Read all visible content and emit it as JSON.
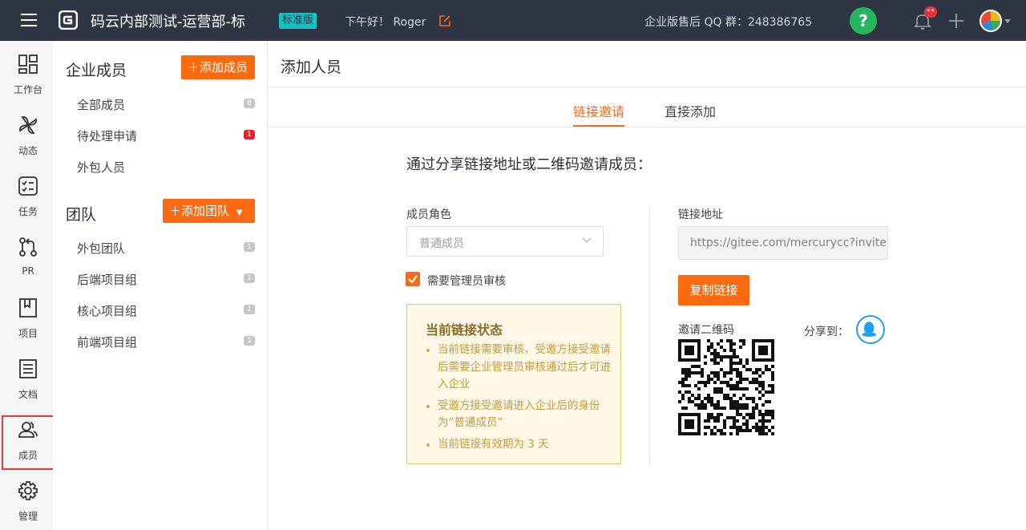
{
  "header": {
    "org_name": "码云内部测试-运营部-标",
    "edition": "标准版",
    "greeting": "下午好！ Roger",
    "qq_group": "企业版售后 QQ 群：248386765",
    "help": "?",
    "notification_badge": "••"
  },
  "leftnav": {
    "items": [
      {
        "label": "工作台",
        "icon": "grid-icon"
      },
      {
        "label": "动态",
        "icon": "pinwheel-icon"
      },
      {
        "label": "任务",
        "icon": "checklist-icon"
      },
      {
        "label": "PR",
        "icon": "pull-request-icon"
      },
      {
        "label": "项目",
        "icon": "book-icon"
      },
      {
        "label": "文档",
        "icon": "document-icon"
      },
      {
        "label": "成员",
        "icon": "users-icon"
      },
      {
        "label": "管理",
        "icon": "gear-icon"
      }
    ],
    "active": "成员"
  },
  "subnav": {
    "members_title": "企业成员",
    "add_member": "添加成员",
    "member_items": [
      {
        "label": "全部成员",
        "count": "8"
      },
      {
        "label": "待处理申请",
        "count": "1"
      },
      {
        "label": "外包人员",
        "count": ""
      }
    ],
    "teams_title": "团队",
    "add_team": "添加团队",
    "team_items": [
      {
        "label": "外包团队",
        "count": "1"
      },
      {
        "label": "后端项目组",
        "count": "1"
      },
      {
        "label": "核心项目组",
        "count": "1"
      },
      {
        "label": "前端项目组",
        "count": "1"
      }
    ]
  },
  "main": {
    "title": "添加人员",
    "tabs": [
      {
        "label": "链接邀请",
        "active": true
      },
      {
        "label": "直接添加",
        "active": false
      }
    ],
    "intro": "通过分享链接地址或二维码邀请成员：",
    "role_label": "成员角色",
    "role_value": "普通成员",
    "require_review": "需要管理员审核",
    "status_title": "当前链接状态",
    "status_items": [
      "当前链接需要审核，受邀方接受邀请后需要企业管理员审核通过后才可进入企业",
      "受邀方接受邀请进入企业后的身份为“普通成员”",
      "当前链接有效期为 3 天"
    ],
    "link_label": "链接地址",
    "link_value": "https://gitee.com/mercurycc?invite=",
    "copy_button": "复制链接",
    "qr_label": "邀请二维码",
    "share_label": "分享到："
  },
  "colors": {
    "topbar": "#2f3542",
    "accent": "#fb6a10",
    "help_green": "#27b55f",
    "status_bg": "#fff8e6"
  }
}
